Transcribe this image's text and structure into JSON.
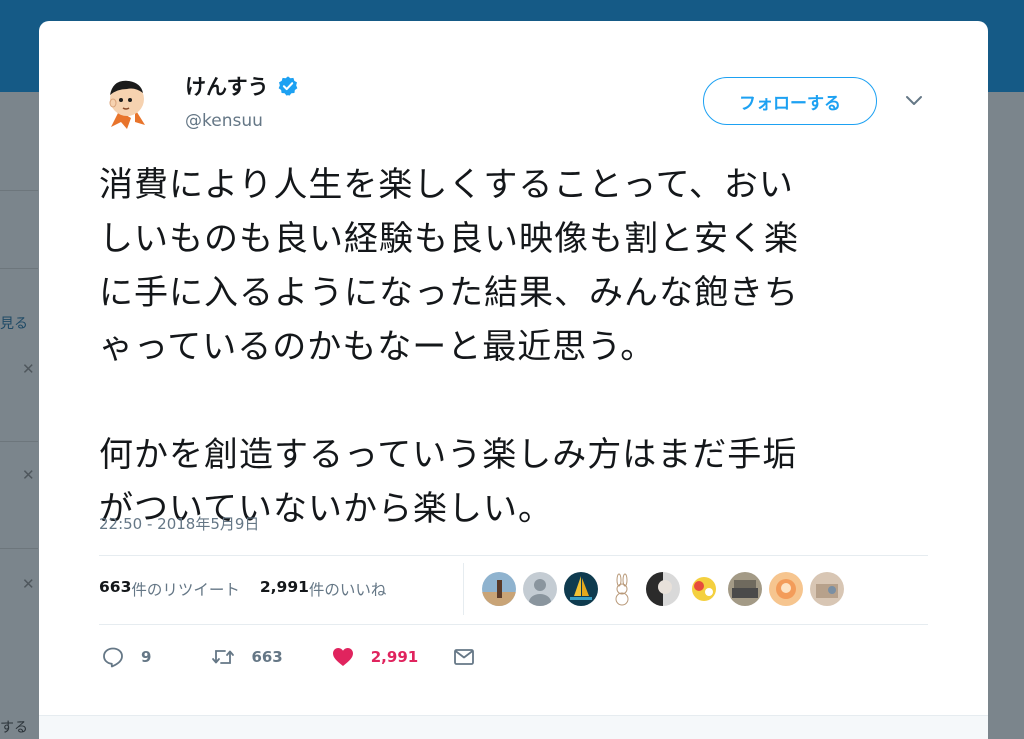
{
  "tweet": {
    "display_name": "けんすう",
    "handle": "@kensuu",
    "follow_label": "フォローする",
    "text": "消費により人生を楽しくすることって、おい\nしいものも良い経験も良い映像も割と安く楽\nに手に入るようになった結果、みんな飽きち\nゃっているのかもなーと最近思う。\n\n何かを創造するっていう楽しみ方はまだ手垢\nがついていないから楽しい。",
    "timestamp": "22:50 - 2018年5月9日",
    "retweets_count": "663",
    "retweets_suffix": "件のリツイート",
    "likes_count": "2,991",
    "likes_suffix": "件のいいね",
    "reply_count": "9",
    "retweet_action_count": "663",
    "like_action_count": "2,991"
  },
  "background": {
    "side_text_1": "見る",
    "side_text_2": "する"
  },
  "colors": {
    "accent": "#1da1f2",
    "like": "#e0245e",
    "header": "#155a86",
    "muted": "#657786"
  },
  "icons": [
    "verified-badge-icon",
    "caret-down-icon",
    "reply-icon",
    "retweet-icon",
    "heart-icon",
    "envelope-icon"
  ]
}
